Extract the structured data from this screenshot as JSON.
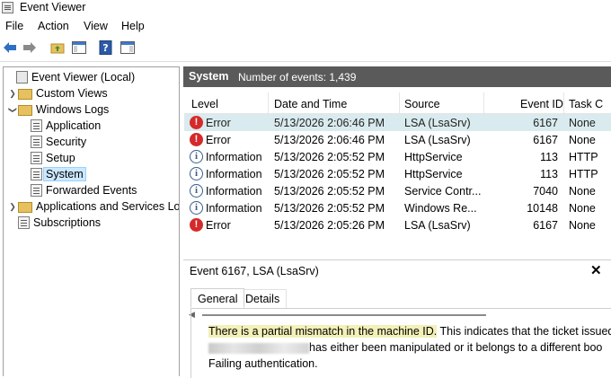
{
  "window": {
    "title": "Event Viewer"
  },
  "menu": [
    "File",
    "Action",
    "View",
    "Help"
  ],
  "toolbar": {
    "icons": [
      "back-arrow-icon",
      "forward-arrow-icon",
      "folder-up-icon",
      "show-hide-tree-icon",
      "help-icon",
      "show-hide-action-pane-icon"
    ]
  },
  "tree": {
    "root": "Event Viewer (Local)",
    "custom_views": "Custom Views",
    "windows_logs": "Windows Logs",
    "logs": [
      "Application",
      "Security",
      "Setup",
      "System",
      "Forwarded Events"
    ],
    "apps_services": "Applications and Services Lo",
    "subscriptions": "Subscriptions",
    "selected": "System"
  },
  "header": {
    "log_name": "System",
    "count": "Number of events: 1,439"
  },
  "grid": {
    "columns": [
      "Level",
      "Date and Time",
      "Source",
      "Event ID",
      "Task C"
    ],
    "rows": [
      {
        "level": "Error",
        "type": "error",
        "datetime": "5/13/2026 2:06:46 PM",
        "source": "LSA (LsaSrv)",
        "event_id": "6167",
        "task": "None"
      },
      {
        "level": "Error",
        "type": "error",
        "datetime": "5/13/2026 2:06:46 PM",
        "source": "LSA (LsaSrv)",
        "event_id": "6167",
        "task": "None"
      },
      {
        "level": "Information",
        "type": "info",
        "datetime": "5/13/2026 2:05:52 PM",
        "source": "HttpService",
        "event_id": "113",
        "task": "HTTP"
      },
      {
        "level": "Information",
        "type": "info",
        "datetime": "5/13/2026 2:05:52 PM",
        "source": "HttpService",
        "event_id": "113",
        "task": "HTTP"
      },
      {
        "level": "Information",
        "type": "info",
        "datetime": "5/13/2026 2:05:52 PM",
        "source": "Service Contr...",
        "event_id": "7040",
        "task": "None"
      },
      {
        "level": "Information",
        "type": "info",
        "datetime": "5/13/2026 2:05:52 PM",
        "source": "Windows Re...",
        "event_id": "10148",
        "task": "None"
      },
      {
        "level": "Error",
        "type": "error",
        "datetime": "5/13/2026 2:05:26 PM",
        "source": "LSA (LsaSrv)",
        "event_id": "6167",
        "task": "None"
      }
    ]
  },
  "detail": {
    "title": "Event 6167, LSA (LsaSrv)",
    "close": "✕",
    "tabs": [
      "General",
      "Details"
    ],
    "line1_highlight": "There is a partial mismatch in the machine ID.",
    "line1_rest": " This indicates that the ticket issued b",
    "line2_rest": "has either been manipulated or it belongs to a different boo",
    "line3": "Failing authentication."
  }
}
